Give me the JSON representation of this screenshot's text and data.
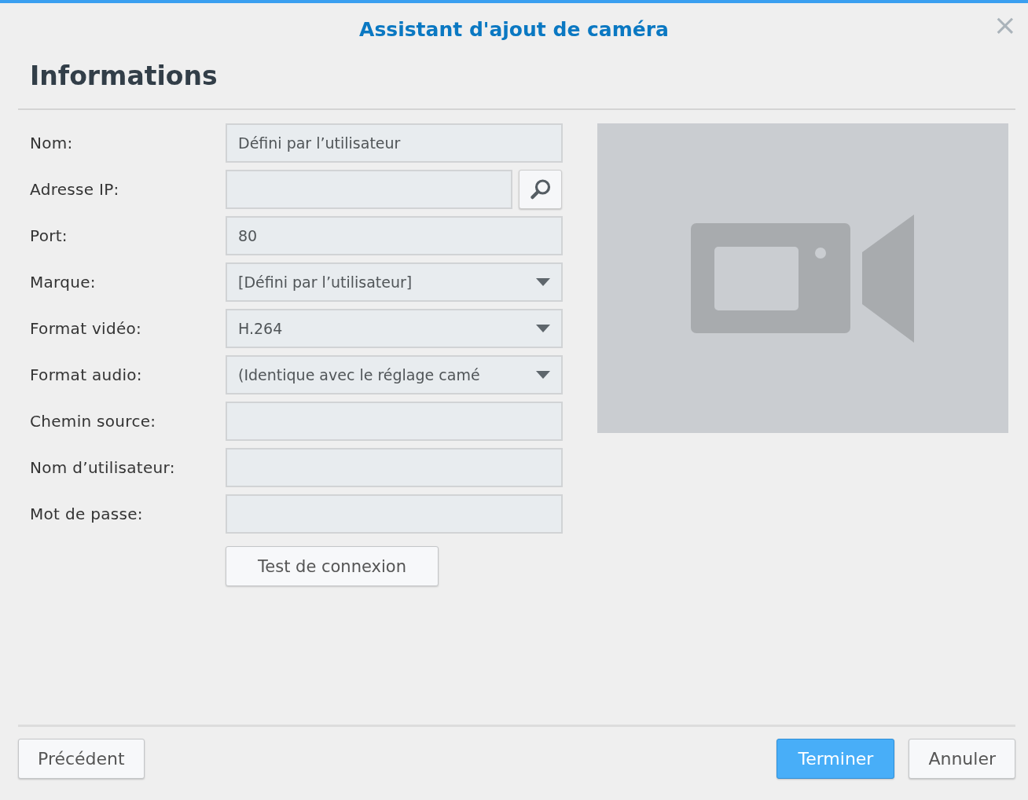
{
  "window": {
    "title": "Assistant d'ajout de caméra",
    "close": "×"
  },
  "section_title": "Informations",
  "fields": [
    {
      "kind": "text",
      "label": "Nom:",
      "value": "Défini par l’utilisateur"
    },
    {
      "kind": "search",
      "label": "Adresse IP:"
    },
    {
      "kind": "text",
      "label": "Port:",
      "value": "80"
    },
    {
      "kind": "select",
      "label": "Marque:",
      "value": "[Défini par l’utilisateur]"
    },
    {
      "kind": "select",
      "label": "Format vidéo:",
      "value": "H.264"
    },
    {
      "kind": "select",
      "label": "Format audio:",
      "value": "(Identique avec le réglage camé"
    },
    {
      "kind": "text",
      "label": "Chemin source:"
    },
    {
      "kind": "text",
      "label": "Nom d’utilisateur:"
    },
    {
      "kind": "password",
      "label": "Mot de passe:"
    }
  ],
  "test_button": "Test de connexion",
  "footer": {
    "back": "Précédent",
    "buttons": [
      {
        "label": "Terminer",
        "primary": true
      },
      {
        "label": "Annuler",
        "primary": false
      }
    ]
  }
}
